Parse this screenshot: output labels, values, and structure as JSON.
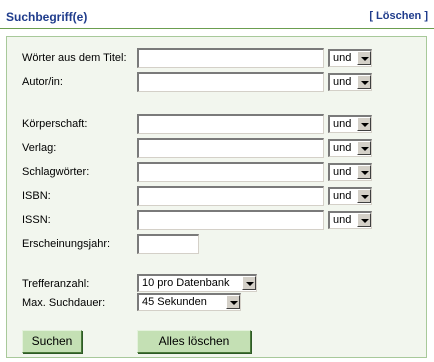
{
  "header": {
    "title": "Suchbegriff(e)",
    "clear_link": "[ Löschen ]"
  },
  "fields": [
    {
      "label": "Wörter aus dem Titel:",
      "value": "",
      "operator": "und"
    },
    {
      "label": "Autor/in:",
      "value": "",
      "operator": "und"
    },
    {
      "label": "Körperschaft:",
      "value": "",
      "operator": "und"
    },
    {
      "label": "Verlag:",
      "value": "",
      "operator": "und"
    },
    {
      "label": "Schlagwörter:",
      "value": "",
      "operator": "und"
    },
    {
      "label": "ISBN:",
      "value": "",
      "operator": "und"
    },
    {
      "label": "ISSN:",
      "value": "",
      "operator": "und"
    }
  ],
  "year": {
    "label": "Erscheinungsjahr:",
    "value": ""
  },
  "hits": {
    "label": "Trefferanzahl:",
    "selected": "10 pro Datenbank"
  },
  "duration": {
    "label": "Max. Suchdauer:",
    "selected": "45 Sekunden"
  },
  "buttons": {
    "search": "Suchen",
    "clear_all": "Alles löschen"
  }
}
